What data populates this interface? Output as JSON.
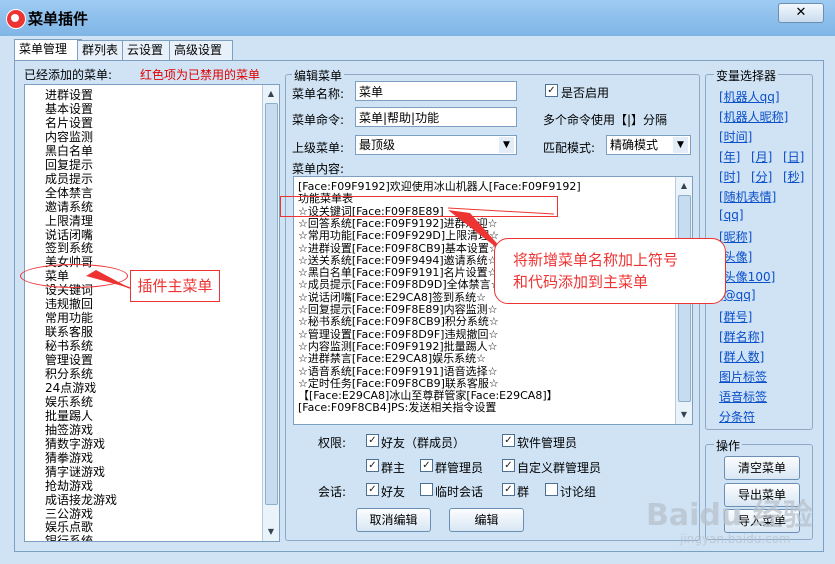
{
  "window": {
    "title": "菜单插件",
    "close_glyph": "✕"
  },
  "tabs": [
    "菜单管理",
    "群列表",
    "云设置",
    "高级设置"
  ],
  "left": {
    "added_label": "已经添加的菜单:",
    "disabled_note": "红色项为已禁用的菜单",
    "items": [
      "进群设置",
      "基本设置",
      "名片设置",
      "内容监测",
      "黑白名单",
      "回复提示",
      "成员提示",
      "全体禁言",
      "邀请系统",
      "上限清理",
      "说话闭嘴",
      "签到系统",
      "美女帅哥",
      "菜单",
      "设关键词",
      "违规撤回",
      "常用功能",
      "联系客服",
      "秘书系统",
      "管理设置",
      "积分系统",
      "24点游戏",
      "娱乐系统",
      "批量踢人",
      "抽签游戏",
      "猜数字游戏",
      "猜拳游戏",
      "猜字谜游戏",
      "抢劫游戏",
      "成语接龙游戏",
      "三公游戏",
      "娱乐点歌",
      "银行系统"
    ]
  },
  "edit": {
    "group_title": "编辑菜单",
    "name_label": "菜单名称:",
    "name_value": "菜单",
    "enabled_label": "是否启用",
    "command_label": "菜单命令:",
    "command_value": "菜单|帮助|功能",
    "command_hint": "多个命令使用【|】分隔",
    "parent_label": "上级菜单:",
    "parent_value": "最顶级",
    "match_label": "匹配模式:",
    "match_value": "精确模式",
    "content_label": "菜单内容:",
    "content_lines": [
      "[Face:F09F9192]欢迎使用冰山机器人[Face:F09F9192]",
      "     功能菜单表",
      "☆设关键词[Face:F09F8E89]",
      "☆回答系统[Face:F09F9192]进群欢迎☆",
      "☆常用功能[Face:F09F929D]上限清理☆",
      "☆进群设置[Face:F09F8CB9]基本设置☆",
      "☆送关系统[Face:F09F9494]邀请系统☆",
      "☆黑白名单[Face:F09F9191]名片设置☆",
      "☆成员提示[Face:F09F8D9D]全体禁言☆",
      "☆说话闭嘴[Face:E29CA8]签到系统☆",
      "☆回复提示[Face:F09F8E89]内容监测☆",
      "☆秘书系统[Face:F09F8CB9]积分系统☆",
      "☆管理设置[Face:F09F8D9F]违规撤回☆",
      "☆内容监测[Face:F09F9192]批量踢人☆",
      "☆进群禁言[Face:E29CA8]娱乐系统☆",
      "☆语音系统[Face:F09F9191]语音选择☆",
      "☆定时任务[Face:F09F8CB9]联系客服☆",
      "【[Face:E29CA8]冰山至尊群管家[Face:E29CA8]】",
      "[Face:F09F8CB4]PS:发送相关指令设置"
    ],
    "perm_label": "权限:",
    "perms": [
      "好友（群成员）",
      "软件管理员",
      "群主",
      "群管理员",
      "自定义群管理员"
    ],
    "session_label": "会话:",
    "sessions": [
      "好友",
      "临时会话",
      "群",
      "讨论组"
    ],
    "cancel_btn": "取消编辑",
    "edit_btn": "编辑"
  },
  "vars": {
    "title": "变量选择器",
    "links": [
      "[机器人qq]",
      "[机器人昵称]",
      "[时间]",
      "[年]",
      "[月]",
      "[日]",
      "[时]",
      "[分]",
      "[秒]",
      "[随机表情]",
      "[qq]",
      "[昵称]",
      "[头像]",
      "[头像100]",
      "[@qq]",
      "[群号]",
      "[群名称]",
      "[群人数]",
      "图片标签",
      "语音标签",
      "分条符"
    ]
  },
  "ops": {
    "title": "操作",
    "clear": "清空菜单",
    "export": "导出菜单",
    "import": "导入菜单"
  },
  "annotations": {
    "main_menu_note": "插件主菜单",
    "add_note_line1": "将新增菜单名称加上符号",
    "add_note_line2": "和代码添加到主菜单"
  },
  "watermark": {
    "brand": "Baidu 经验",
    "url": "jingyan.baidu.com"
  },
  "colors": {
    "accent": "#e00000",
    "link": "#0b4fc9",
    "window_bg": "#cfe3f5"
  }
}
